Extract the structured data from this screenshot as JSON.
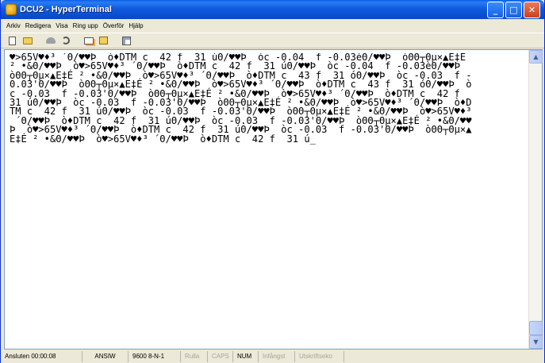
{
  "window": {
    "title": "DCU2 - HyperTerminal",
    "caption_buttons": {
      "minimize": "_",
      "maximize": "□",
      "close": "✕"
    }
  },
  "menu": {
    "items": [
      "Arkiv",
      "Redigera",
      "Visa",
      "Ring upp",
      "Överför",
      "Hjälp"
    ]
  },
  "toolbar": {
    "icons": [
      "new-document-icon",
      "open-folder-icon",
      "connect-phone-icon",
      "disconnect-icon",
      "send-file-icon",
      "receive-file-icon",
      "properties-icon"
    ]
  },
  "terminal": {
    "lines": [
      "♥>65V♥♦³ ´Θ/♥♥Þ  ò♦DTM c  42 f  31 úΘ/♥♥Þ  òc -0.04  f -0.03èΘ/♥♥Þ  òΘΘ┬Θµ×▲E‡É",
      "² •&Θ/♥♥Þ  ò♥>65V♥♦³ ´Θ/♥♥Þ  ò♦DTM c  42 f  31 úΘ/♥♥Þ  òc -0.04  f -0.03èΘ/♥♥Þ",
      "òΘΘ┬Θµ×▲E‡É ² •&Θ/♥♥Þ  ò♥>65V♥♦³ ´Θ/♥♥Þ  ò♦DTM c  43 f  31 óΘ/♥♥Þ  òc -0.03  f -",
      "0.03'Θ/♥♥Þ  òΘΘ┬Θµ×▲E‡É ² •&Θ/♥♥Þ  ò♥>65V♥♦³ ´Θ/♥♥Þ  ò♦DTM c  43 f  31 óΘ/♥♥Þ  ò",
      "c -0.03  f -0.03'Θ/♥♥Þ  òΘΘ┬Θµ×▲E‡É ² •&Θ/♥♥Þ  ò♥>65V♥♦³ ´Θ/♥♥Þ  ò♦DTM c  42 f",
      "31 úΘ/♥♥Þ  òc -0.03  f -0.03'Θ/♥♥Þ  òΘΘ┬Θµ×▲E‡É ² •&Θ/♥♥Þ  ò♥>65V♥♦³ ´Θ/♥♥Þ  ò♦D",
      "TM c  42 f  31 úΘ/♥♥Þ  òc -0.03  f -0.03'Θ/♥♥Þ  òΘΘ┬Θµ×▲E‡É ² •&Θ/♥♥Þ  ò♥>65V♥♦³",
      " ´Θ/♥♥Þ  ò♦DTM c  42 f  31 úΘ/♥♥Þ  òc -0.03  f -0.03'Θ/♥♥Þ  òΘΘ┬Θµ×▲E‡É ² •&Θ/♥♥",
      "Þ  ò♥>65V♥♦³ ´Θ/♥♥Þ  ò♦DTM c  42 f  31 úΘ/♥♥Þ  òc -0.03  f -0.03'Θ/♥♥Þ  òΘΘ┬Θµ×▲",
      "E‡É ² •&Θ/♥♥Þ  ò♥>65V♥♦³ ´Θ/♥♥Þ  ò♦DTM c  42 f  31 ú_"
    ]
  },
  "statusbar": {
    "connection": "Ansluten 00:00:08",
    "emulation": "ANSIW",
    "port_settings": "9600 8-N-1",
    "scroll": "Rulla",
    "caps": "CAPS",
    "num": "NUM",
    "capture": "Infångst",
    "print_echo": "Utskriftseko"
  }
}
